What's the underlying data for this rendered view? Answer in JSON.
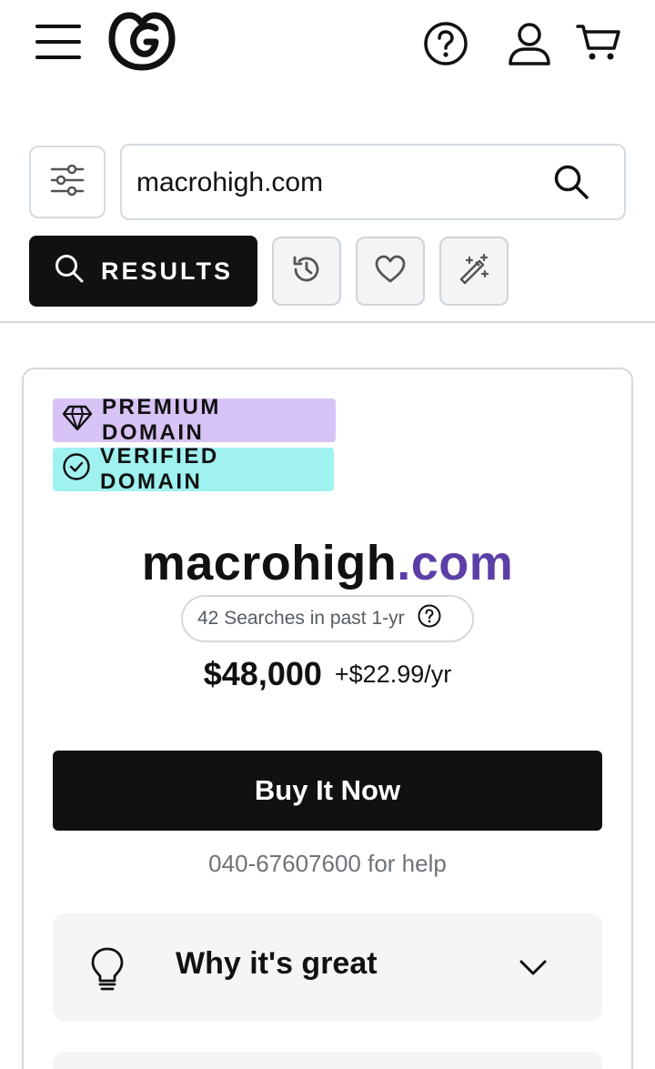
{
  "header": {
    "menu_icon": "hamburger-icon",
    "logo_icon": "godaddy-logo",
    "help_icon": "help-circle-icon",
    "account_icon": "user-icon",
    "cart_icon": "cart-icon"
  },
  "search": {
    "filter_icon": "sliders-icon",
    "value": "macrohigh.com",
    "placeholder": "",
    "submit_icon": "search-icon"
  },
  "tabs": {
    "results_label": "RESULTS",
    "history_icon": "history-icon",
    "favorites_icon": "heart-icon",
    "generator_icon": "magic-wand-icon"
  },
  "result": {
    "badges": [
      {
        "label": "PREMIUM DOMAIN",
        "icon": "diamond-icon",
        "color": "#d7c3f5"
      },
      {
        "label": "VERIFIED DOMAIN",
        "icon": "check-circle-icon",
        "color": "#9ff2f0"
      }
    ],
    "domain_sld": "macrohigh",
    "domain_tld": ".com",
    "searches_text": "42 Searches in past 1-yr",
    "price": "$48,000",
    "renewal": "+$22.99/yr",
    "buy_label": "Buy It Now",
    "help_text": "040-67607600 for help",
    "why_label": "Why it's great"
  },
  "colors": {
    "primary_button": "#111111",
    "tld_accent": "#5b3fa6",
    "panel_bg": "#f4f5f7"
  }
}
